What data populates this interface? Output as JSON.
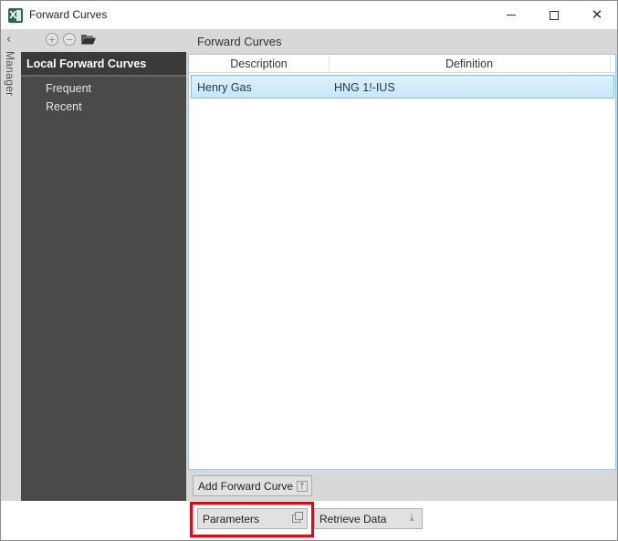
{
  "window": {
    "title": "Forward Curves"
  },
  "manager": {
    "collapse_icon": "chevron-left",
    "label": "Manager"
  },
  "toolbar": {
    "add_icon": "add-circle",
    "remove_icon": "remove-circle",
    "open_icon": "folder-open"
  },
  "panel": {
    "title": "Forward Curves"
  },
  "nav": {
    "header": "Local Forward Curves",
    "items": [
      {
        "label": "Frequent"
      },
      {
        "label": "Recent"
      }
    ]
  },
  "grid": {
    "columns": [
      "Description",
      "Definition"
    ],
    "rows": [
      {
        "description": "Henry Gas",
        "definition": "HNG 1!-IUS",
        "selected": true
      }
    ]
  },
  "buttons": {
    "add_forward_curve": "Add Forward Curve",
    "parameters": "Parameters",
    "retrieve_data": "Retrieve Data"
  },
  "colors": {
    "highlight_box": "#e30613",
    "nav_bg": "#4a4a4a",
    "selected_row": "#c6e6fa"
  }
}
